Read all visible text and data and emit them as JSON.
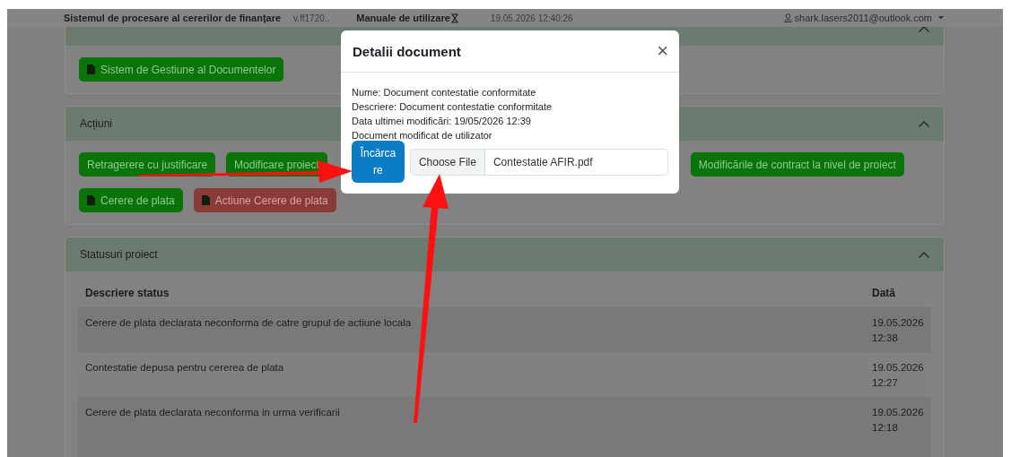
{
  "header": {
    "app_title": "Sistemul de procesare al cererilor de finanțare",
    "version": "v.ff1720..",
    "manuals": "Manuale de utilizare",
    "datetime": "19.05.2026 12:40:26",
    "user": "shark.lasers2011@outlook.com"
  },
  "sections": [
    {
      "expanded": true,
      "button_rows": [
        [
          {
            "label": "Sistem de Gestiune al Documentelor",
            "kind": "success",
            "icon": true
          }
        ]
      ]
    },
    {
      "title": "Acțiuni",
      "expanded": true,
      "button_rows": [
        [
          {
            "label": "Retragerere cu justificare",
            "kind": "success",
            "icon": false
          },
          {
            "label": "Modificare proiect",
            "kind": "success",
            "icon": false
          },
          {
            "label": "Modificările de contract la nivel de proiect",
            "kind": "success",
            "icon": false
          }
        ],
        [
          {
            "label": "Cerere de plata",
            "kind": "success",
            "icon": true
          },
          {
            "label": "Actiune Cerere de plata",
            "kind": "danger",
            "icon": true
          }
        ]
      ]
    },
    {
      "title": "Statusuri proiect",
      "expanded": true,
      "table": {
        "columns": [
          "Descriere status",
          "Dată"
        ],
        "rows": [
          [
            "Cerere de plata declarata neconforma de catre grupul de actiune locala",
            "19.05.2026 12:38"
          ],
          [
            "Contestatie depusa pentru cererea de plata",
            "19.05.2026 12:27"
          ],
          [
            "Cerere de plata declarata neconforma in urma verificarii",
            "19.05.2026 12:18"
          ]
        ]
      }
    }
  ],
  "modal": {
    "title": "Detalii document",
    "close": "×",
    "lines": [
      "Nume: Document contestatie conformitate",
      "Descriere: Document contestatie conformitate",
      "Data ultimei modificări: 19/05/2026 12:39",
      "Document modificat de utilizator"
    ],
    "upload_button": "Încărcare",
    "file_button": "Choose File",
    "file_name": "Contestatie AFIR.pdf"
  }
}
